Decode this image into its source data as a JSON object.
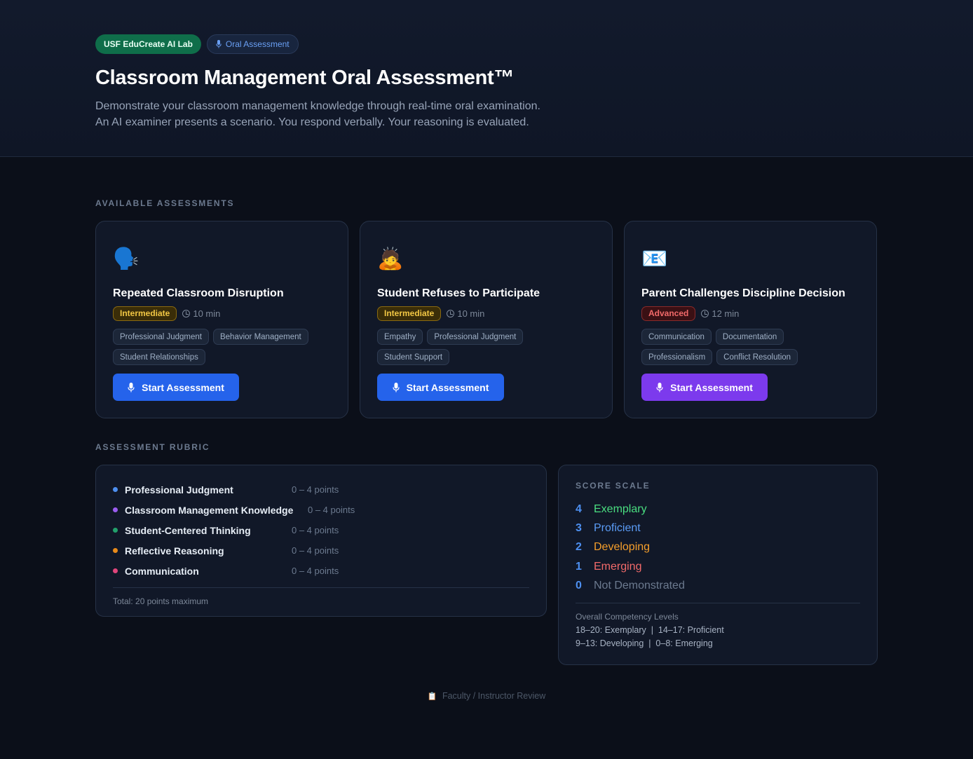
{
  "header": {
    "lab_badge": "USF EduCreate AI Lab",
    "mode_badge": "Oral Assessment",
    "title": "Classroom Management Oral Assessment™",
    "subtitle_line1": "Demonstrate your classroom management knowledge through real-time oral examination.",
    "subtitle_line2": "An AI examiner presents a scenario. You respond verbally. Your reasoning is evaluated."
  },
  "sections": {
    "available": "AVAILABLE ASSESSMENTS",
    "rubric": "ASSESSMENT RUBRIC"
  },
  "assessments": [
    {
      "icon": "🗣️",
      "icon_name": "speaking-head-icon",
      "title": "Repeated Classroom Disruption",
      "level": "Intermediate",
      "duration": "10 min",
      "tags": [
        "Professional Judgment",
        "Behavior Management",
        "Student Relationships"
      ],
      "button": "Start Assessment",
      "button_color": "#2563eb"
    },
    {
      "icon": "🙇",
      "icon_name": "bowing-person-icon",
      "title": "Student Refuses to Participate",
      "level": "Intermediate",
      "duration": "10 min",
      "tags": [
        "Empathy",
        "Professional Judgment",
        "Student Support"
      ],
      "button": "Start Assessment",
      "button_color": "#2563eb"
    },
    {
      "icon": "📧",
      "icon_name": "email-icon",
      "title": "Parent Challenges Discipline Decision",
      "level": "Advanced",
      "duration": "12 min",
      "tags": [
        "Communication",
        "Documentation",
        "Professionalism",
        "Conflict Resolution"
      ],
      "button": "Start Assessment",
      "button_color": "#7c3aed"
    }
  ],
  "rubric": {
    "criteria": [
      {
        "name": "Professional Judgment",
        "points": "0 – 4 points",
        "color": "#4d8ff0"
      },
      {
        "name": "Classroom Management Knowledge",
        "points": "0 – 4 points",
        "color": "#9b5cf0"
      },
      {
        "name": "Student-Centered Thinking",
        "points": "0 – 4 points",
        "color": "#22a06b"
      },
      {
        "name": "Reflective Reasoning",
        "points": "0 – 4 points",
        "color": "#e88a1a"
      },
      {
        "name": "Communication",
        "points": "0 – 4 points",
        "color": "#e0457b"
      }
    ],
    "total": "Total: 20 points maximum"
  },
  "score_scale": {
    "title": "SCORE SCALE",
    "levels": [
      {
        "score": "4",
        "label": "Exemplary",
        "color": "#4ade80"
      },
      {
        "score": "3",
        "label": "Proficient",
        "color": "#5b9cf6"
      },
      {
        "score": "2",
        "label": "Developing",
        "color": "#f59e2b"
      },
      {
        "score": "1",
        "label": "Emerging",
        "color": "#f26a6a"
      },
      {
        "score": "0",
        "label": "Not Demonstrated",
        "color": "#6c7a8f"
      }
    ],
    "overall_heading": "Overall Competency Levels",
    "overall_line1": "18–20: Exemplary  |  14–17: Proficient",
    "overall_line2": "9–13: Developing  |  0–8: Emerging"
  },
  "footer": {
    "icon": "📋",
    "text": "Faculty / Instructor Review"
  }
}
